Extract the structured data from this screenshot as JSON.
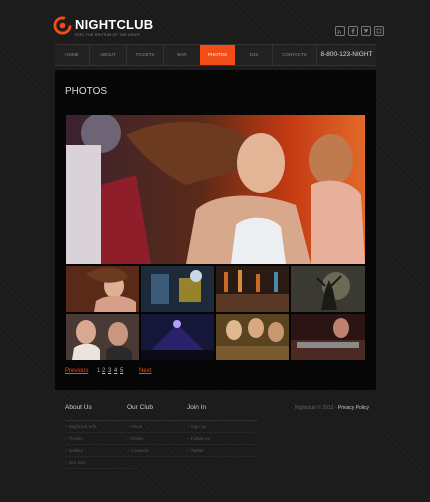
{
  "header": {
    "brand": "NIGHTCLUB",
    "tagline": "FEEL THE RHYTHM OF THE NIGHT",
    "social_icons": [
      "rss-icon",
      "facebook-icon",
      "twitter-icon",
      "feed-icon"
    ]
  },
  "nav": {
    "items": [
      "HOME",
      "ABOUT",
      "TICKETS",
      "BAR",
      "PHOTOS",
      "DJS",
      "CONTACTS"
    ],
    "active": "PHOTOS",
    "phone": "8-800-123-NIGHT"
  },
  "main": {
    "title": "PHOTOS"
  },
  "pagination": {
    "previous": "Previous",
    "pages": [
      "1",
      "2",
      "3",
      "4",
      "5"
    ],
    "current": "1",
    "next": "Next"
  },
  "footer": {
    "columns": [
      {
        "title": "About Us",
        "links": [
          "Nightclub Info",
          "Tickets",
          "Gallery",
          "Our DJs"
        ]
      },
      {
        "title": "Our Club",
        "links": [
          "About",
          "Drinks",
          "Contacts"
        ]
      },
      {
        "title": "Join In",
        "links": [
          "Sign up",
          "Follow us",
          "Twitter"
        ]
      }
    ],
    "copyright": "Nightclub © 2012 ·",
    "privacy": "Privacy Policy"
  },
  "colors": {
    "accent": "#f24d16",
    "background": "#1b1b1b",
    "panel": "#060606"
  }
}
